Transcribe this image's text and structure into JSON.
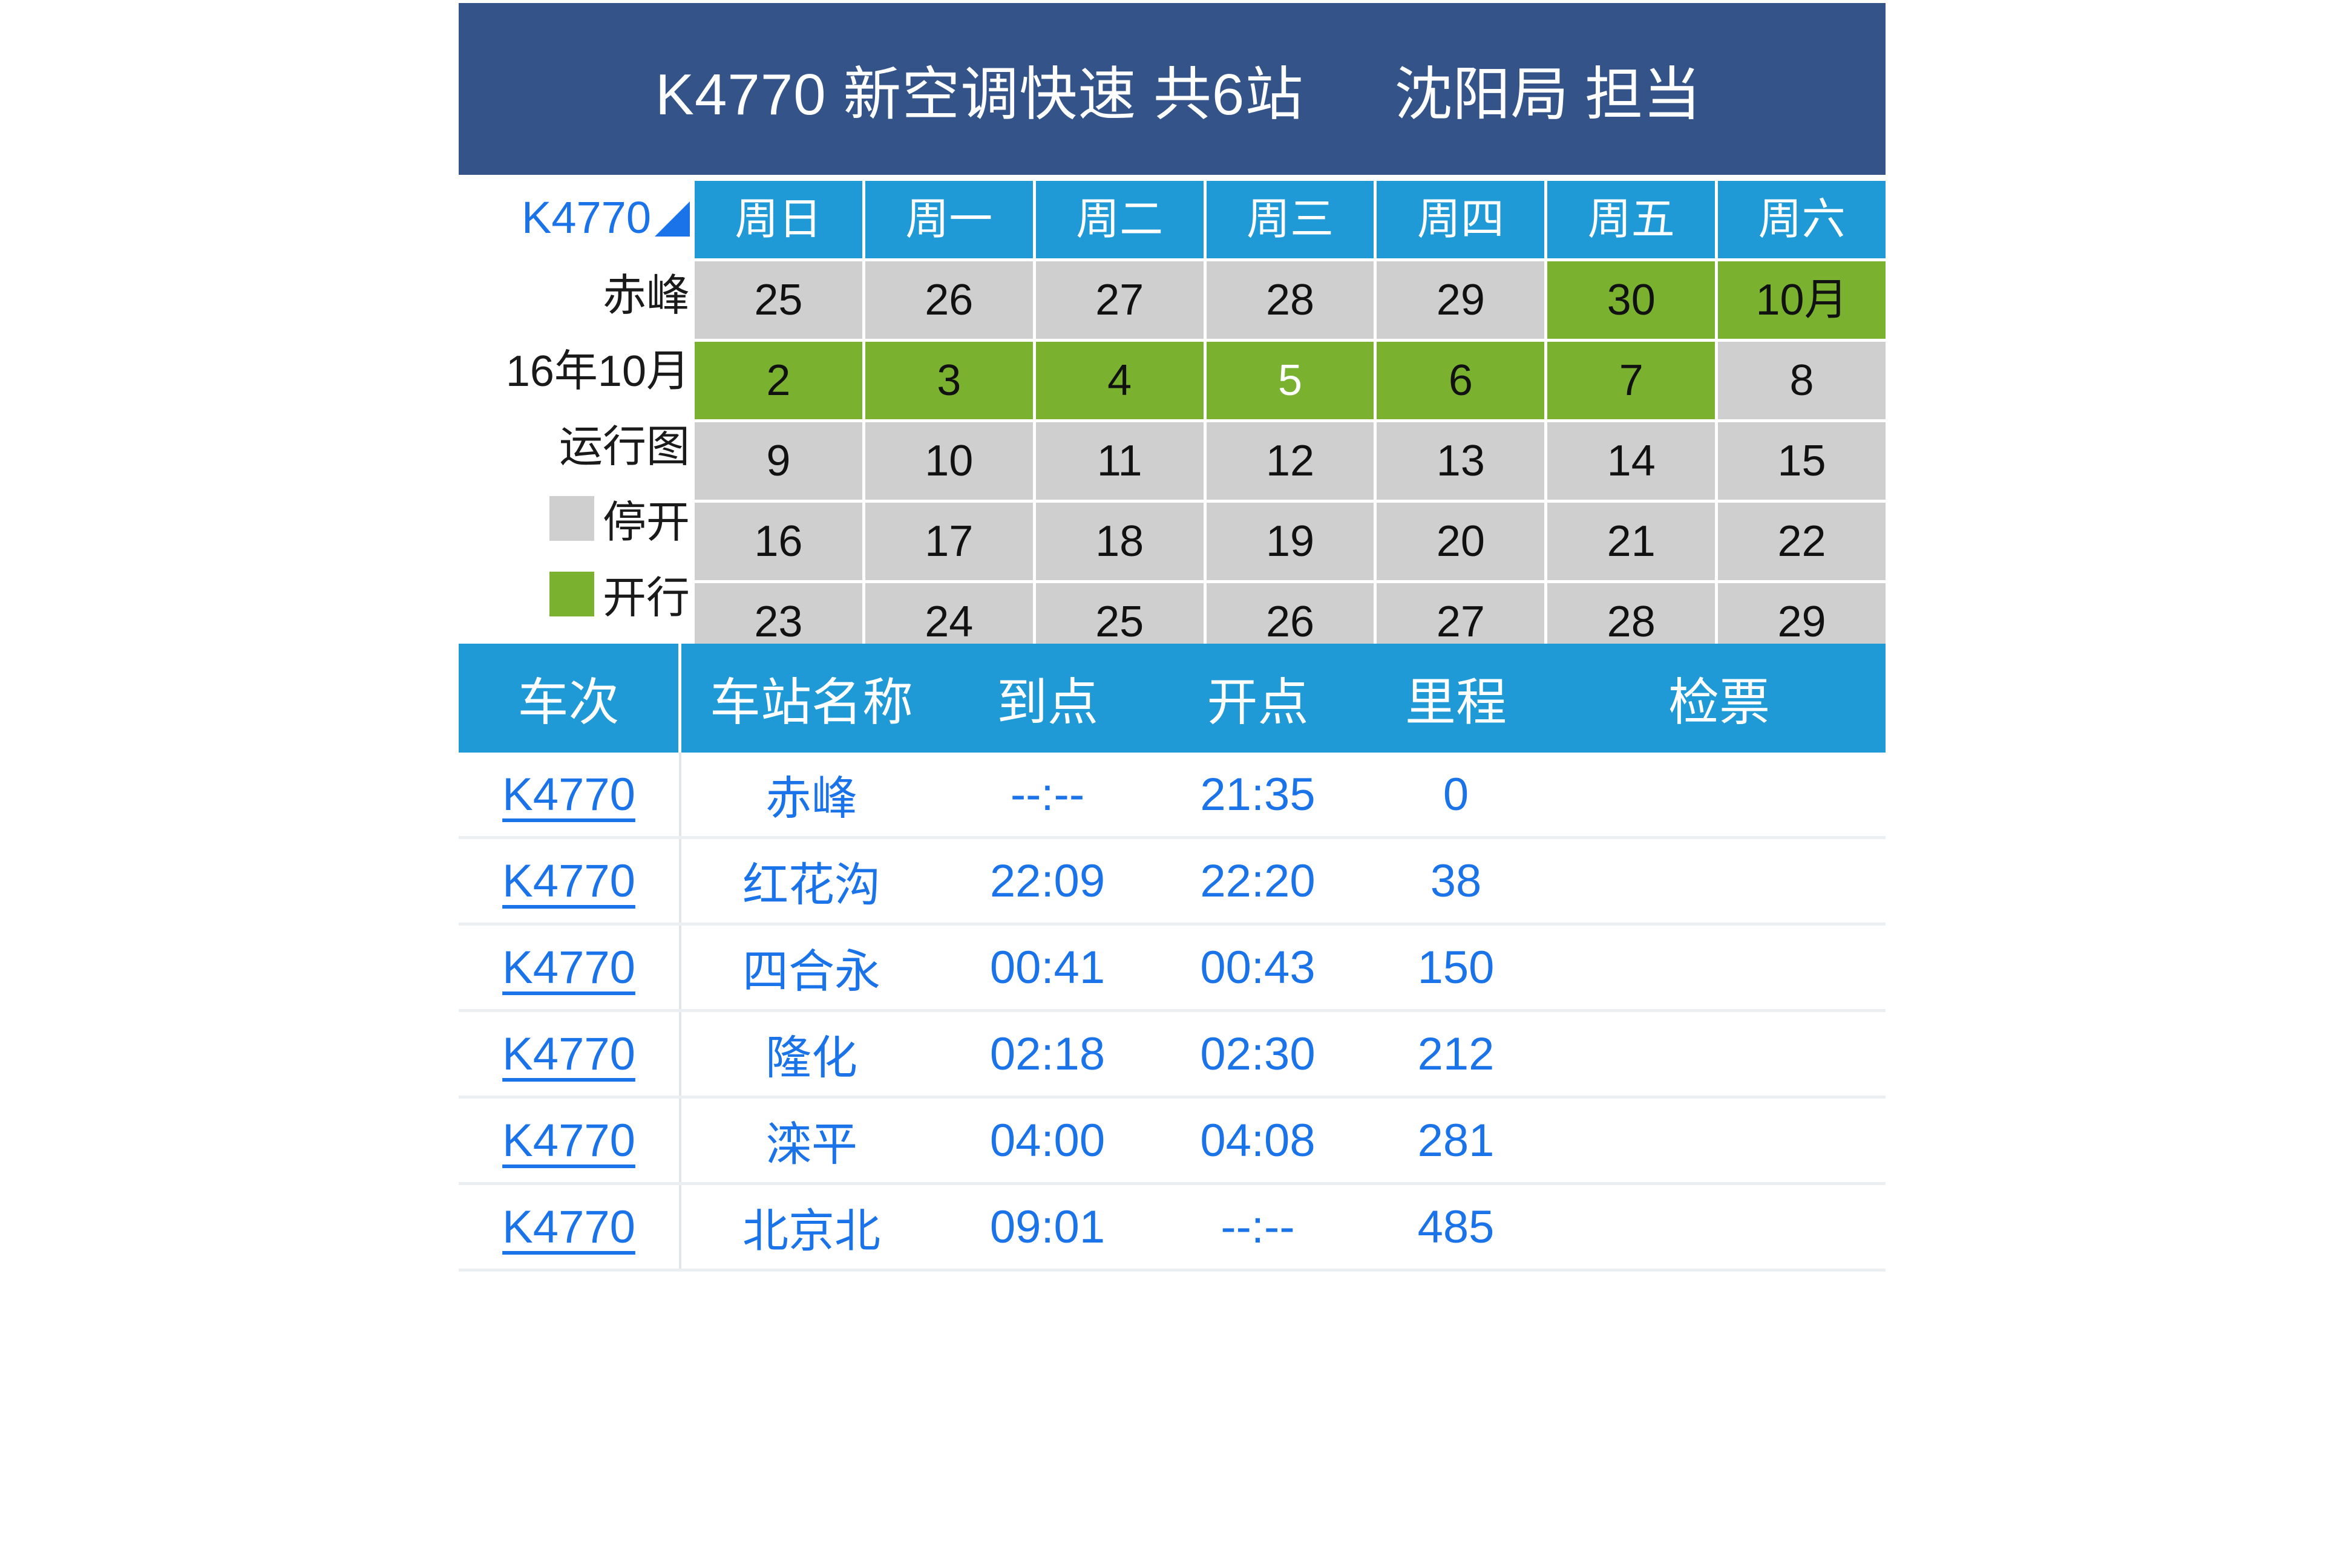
{
  "header": {
    "train_no": "K4770",
    "train_type": "新空调快速",
    "stops_count": "共6站",
    "title": "K4770 新空调快速 共6站",
    "bureau": "沈阳局 担当",
    "band_color": "#345489"
  },
  "calendar": {
    "train_label": "K4770",
    "origin_station": "赤峰",
    "period": "16年10月",
    "chart_label": "运行图",
    "legend": [
      {
        "swatch": "gray",
        "color": "#cfcfcf",
        "label": "停开"
      },
      {
        "swatch": "green",
        "color": "#7ab22f",
        "label": "开行"
      }
    ],
    "weekday_headers": [
      "周日",
      "周一",
      "周二",
      "周三",
      "周四",
      "周五",
      "周六"
    ],
    "header_color": "#1f9ad6",
    "weeks": [
      [
        {
          "day": "25",
          "state": "off"
        },
        {
          "day": "26",
          "state": "off"
        },
        {
          "day": "27",
          "state": "off"
        },
        {
          "day": "28",
          "state": "off"
        },
        {
          "day": "29",
          "state": "off"
        },
        {
          "day": "30",
          "state": "on"
        },
        {
          "day": "10月",
          "state": "on"
        }
      ],
      [
        {
          "day": "2",
          "state": "on"
        },
        {
          "day": "3",
          "state": "on"
        },
        {
          "day": "4",
          "state": "on"
        },
        {
          "day": "5",
          "state": "on",
          "today": true
        },
        {
          "day": "6",
          "state": "on"
        },
        {
          "day": "7",
          "state": "on"
        },
        {
          "day": "8",
          "state": "off"
        }
      ],
      [
        {
          "day": "9",
          "state": "off"
        },
        {
          "day": "10",
          "state": "off"
        },
        {
          "day": "11",
          "state": "off"
        },
        {
          "day": "12",
          "state": "off"
        },
        {
          "day": "13",
          "state": "off"
        },
        {
          "day": "14",
          "state": "off"
        },
        {
          "day": "15",
          "state": "off"
        }
      ],
      [
        {
          "day": "16",
          "state": "off"
        },
        {
          "day": "17",
          "state": "off"
        },
        {
          "day": "18",
          "state": "off"
        },
        {
          "day": "19",
          "state": "off"
        },
        {
          "day": "20",
          "state": "off"
        },
        {
          "day": "21",
          "state": "off"
        },
        {
          "day": "22",
          "state": "off"
        }
      ],
      [
        {
          "day": "23",
          "state": "off"
        },
        {
          "day": "24",
          "state": "off"
        },
        {
          "day": "25",
          "state": "off"
        },
        {
          "day": "26",
          "state": "off"
        },
        {
          "day": "27",
          "state": "off"
        },
        {
          "day": "28",
          "state": "off"
        },
        {
          "day": "29",
          "state": "off"
        }
      ]
    ]
  },
  "schedule": {
    "columns": {
      "train": "车次",
      "station": "车站名称",
      "arrive": "到点",
      "depart": "开点",
      "mileage": "里程",
      "gate": "检票"
    },
    "header_color": "#1f9ad6",
    "link_color": "#1a73e8",
    "rows": [
      {
        "train": "K4770",
        "station": "赤峰",
        "arrive": "--:--",
        "depart": "21:35",
        "mileage": "0",
        "gate": ""
      },
      {
        "train": "K4770",
        "station": "红花沟",
        "arrive": "22:09",
        "depart": "22:20",
        "mileage": "38",
        "gate": ""
      },
      {
        "train": "K4770",
        "station": "四合永",
        "arrive": "00:41",
        "depart": "00:43",
        "mileage": "150",
        "gate": ""
      },
      {
        "train": "K4770",
        "station": "隆化",
        "arrive": "02:18",
        "depart": "02:30",
        "mileage": "212",
        "gate": ""
      },
      {
        "train": "K4770",
        "station": "滦平",
        "arrive": "04:00",
        "depart": "04:08",
        "mileage": "281",
        "gate": ""
      },
      {
        "train": "K4770",
        "station": "北京北",
        "arrive": "09:01",
        "depart": "--:--",
        "mileage": "485",
        "gate": ""
      }
    ]
  }
}
